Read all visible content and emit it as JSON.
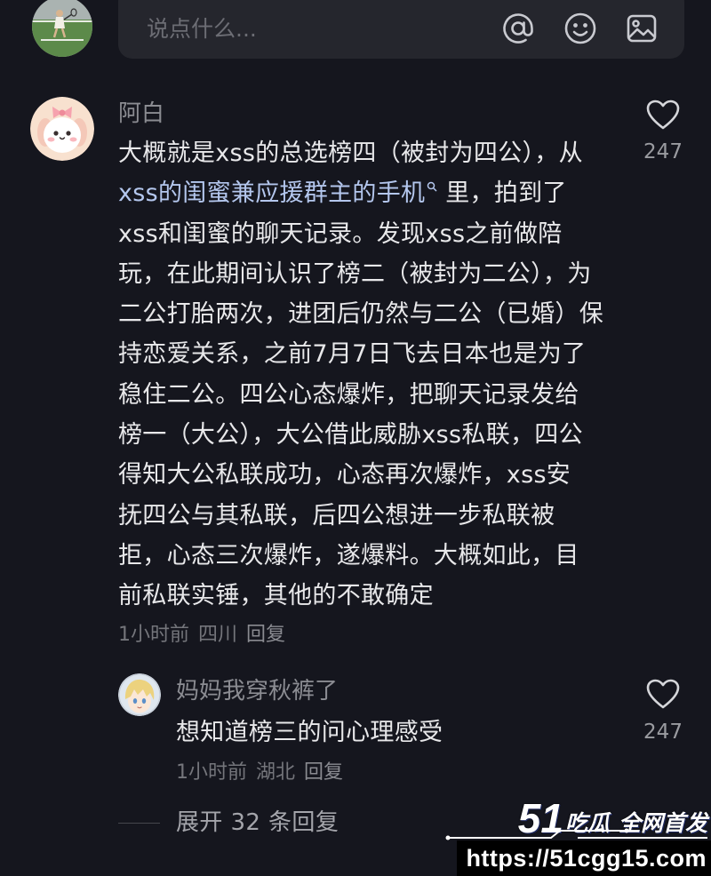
{
  "composer": {
    "placeholder": "说点什么...",
    "icons": {
      "mention": "at-icon",
      "emoji": "emoji-icon",
      "image": "image-icon"
    }
  },
  "comment": {
    "username": "阿白",
    "lines": [
      "大概就是xss的总选榜四（被封为四公），从",
      {
        "keyword": "xss的闺蜜兼应援群主的手机",
        "rest": " 里，拍到了"
      },
      "xss和闺蜜的聊天记录。发现xss之前做陪",
      "玩，在此期间认识了榜二（被封为二公），为",
      "二公打胎两次，进团后仍然与二公（已婚）保",
      "持恋爱关系，之前7月7日飞去日本也是为了",
      "稳住二公。四公心态爆炸，把聊天记录发给",
      "榜一（大公），大公借此威胁xss私联，四公",
      "得知大公私联成功，心态再次爆炸，xss安",
      "抚四公与其私联，后四公想进一步私联被",
      "拒，心态三次爆炸，遂爆料。大概如此，目",
      "前私联实锤，其他的不敢确定"
    ],
    "time": "1小时前",
    "location": "四川",
    "reply_label": "回复",
    "like_icon": "heart-icon",
    "like_count": "247",
    "reply": {
      "username": "妈妈我穿秋裤了",
      "text": "想知道榜三的问心理感受",
      "time": "1小时前",
      "location": "湖北",
      "reply_label": "回复",
      "like_icon": "heart-icon",
      "like_count": "247"
    },
    "expand_label": "展开 32 条回复"
  },
  "watermark": {
    "brand_number": "51",
    "brand_text": "吃瓜",
    "tagline": "全网首发",
    "url": "https://51cgg15.com"
  },
  "colors": {
    "background": "#15161e",
    "text": "#e8e8ea",
    "muted": "#8b8c92",
    "keyword": "#b4c7ee",
    "composer": "#25262d"
  }
}
